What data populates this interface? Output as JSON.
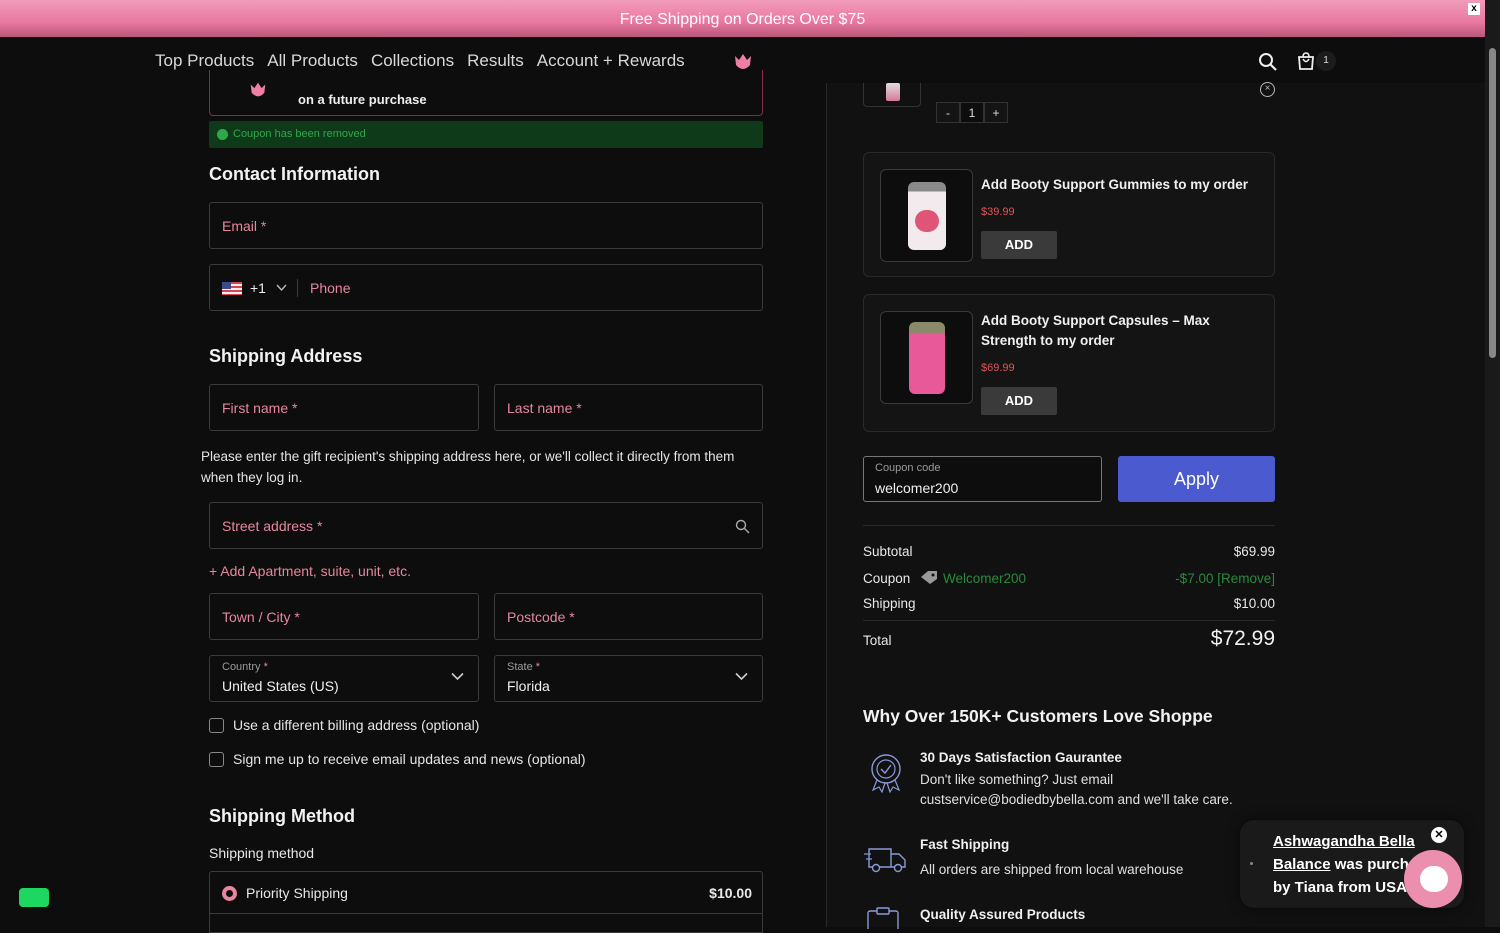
{
  "announcement": {
    "text": "Free Shipping on Orders Over $75",
    "close": "x"
  },
  "nav": {
    "links": [
      "Top Products",
      "All Products",
      "Collections",
      "Results",
      "Account + Rewards"
    ],
    "cart_count": "1"
  },
  "promo": {
    "text": "on a future purchase"
  },
  "coupon_removed": "Coupon has been removed",
  "contact": {
    "title": "Contact Information",
    "email_placeholder": "Email *",
    "phone_code": "+1",
    "phone_placeholder": "Phone"
  },
  "shipping_address": {
    "title": "Shipping Address",
    "first_name": "First name *",
    "last_name": "Last name *",
    "note": "Please enter the gift recipient's shipping address here, or we'll collect it directly from them when they log in.",
    "street": "Street address *",
    "add_apartment": "+ Add Apartment, suite, unit, etc.",
    "city": "Town / City *",
    "postcode": "Postcode *",
    "country_label": "Country",
    "country_value": "United States (US)",
    "state_label": "State",
    "state_value": "Florida"
  },
  "options": {
    "billing": "Use a different billing address (optional)",
    "newsletter": "Sign me up to receive email updates and news (optional)"
  },
  "shipping_method": {
    "title": "Shipping Method",
    "label": "Shipping method",
    "option_name": "Priority Shipping",
    "option_price": "$10.00"
  },
  "cart": {
    "qty_minus": "-",
    "qty_value": "1",
    "qty_plus": "+"
  },
  "upsells": [
    {
      "title": "Add Booty Support Gummies to my order",
      "price": "$39.99",
      "button": "ADD"
    },
    {
      "title": "Add Booty Support Capsules – Max Strength to my order",
      "price": "$69.99",
      "button": "ADD"
    }
  ],
  "coupon": {
    "label": "Coupon code",
    "value": "welcomer200",
    "apply": "Apply"
  },
  "summary": {
    "subtotal_label": "Subtotal",
    "subtotal": "$69.99",
    "coupon_label": "Coupon",
    "coupon_code": "Welcomer200",
    "coupon_value": "-$7.00 [Remove]",
    "shipping_label": "Shipping",
    "shipping": "$10.00",
    "total_label": "Total",
    "total": "$72.99"
  },
  "why": {
    "title": "Why Over 150K+ Customers Love Shoppe",
    "features": [
      {
        "title": "30 Days Satisfaction Gaurantee",
        "desc": "Don't like something? Just email custservice@bodiedbybella.com and we'll take care."
      },
      {
        "title": "Fast Shipping",
        "desc": "All orders are shipped from local warehouse"
      },
      {
        "title": "Quality Assured Products",
        "desc": ""
      }
    ]
  },
  "popup": {
    "line1": "Ashwagandha Bella",
    "line2a": "Balance",
    "line2b": " was purch",
    "line3": "by Tiana from USA"
  },
  "colors": {
    "accent_pink": "#e7879f",
    "apply_blue": "#4b5bcf",
    "success_green": "#2fa84a",
    "price_red": "#e05555"
  }
}
